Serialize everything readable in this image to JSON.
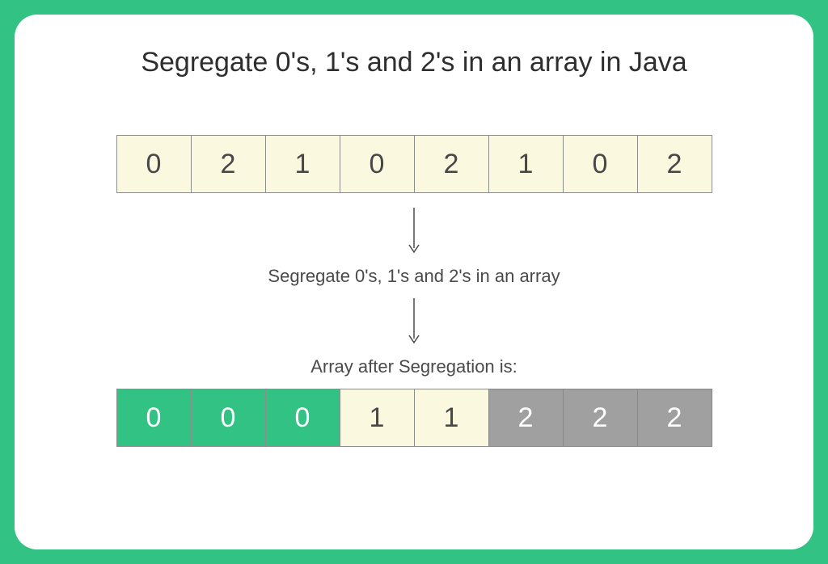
{
  "title": "Segregate 0's, 1's and 2's in an array in Java",
  "step_label": "Segregate 0's, 1's and 2's in an array",
  "result_label": "Array after Segregation is:",
  "colors": {
    "cream": "#fbf8e0",
    "green": "#32c284",
    "grey": "#a0a0a0"
  },
  "chart_data": {
    "type": "table",
    "input_array": [
      0,
      2,
      1,
      0,
      2,
      1,
      0,
      2
    ],
    "output_array": [
      {
        "value": 0,
        "color": "green"
      },
      {
        "value": 0,
        "color": "green"
      },
      {
        "value": 0,
        "color": "green"
      },
      {
        "value": 1,
        "color": "cream"
      },
      {
        "value": 1,
        "color": "cream"
      },
      {
        "value": 2,
        "color": "grey"
      },
      {
        "value": 2,
        "color": "grey"
      },
      {
        "value": 2,
        "color": "grey"
      }
    ]
  }
}
